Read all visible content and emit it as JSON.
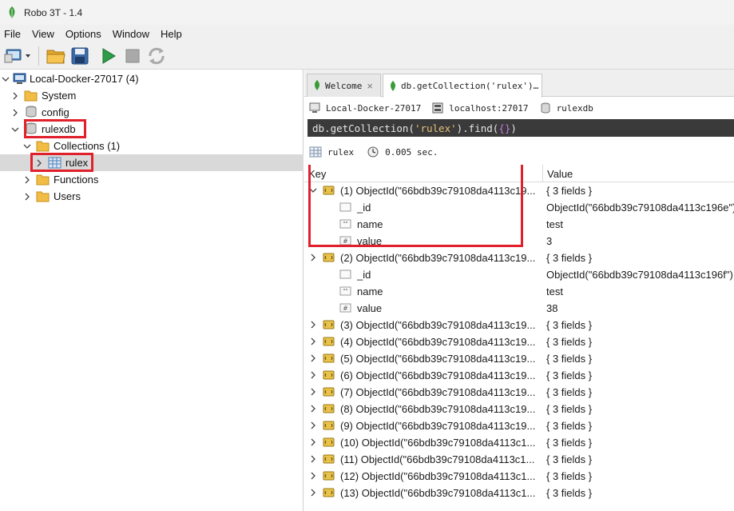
{
  "window": {
    "title": "Robo 3T - 1.4"
  },
  "menu": [
    "File",
    "View",
    "Options",
    "Window",
    "Help"
  ],
  "tree": {
    "connection": "Local-Docker-27017 (4)",
    "system": "System",
    "config": "config",
    "database": "rulexdb",
    "collections": "Collections (1)",
    "collection": "rulex",
    "functions": "Functions",
    "users": "Users"
  },
  "tabs": [
    {
      "label": "Welcome"
    },
    {
      "label": "db.getCollection('rulex')…"
    }
  ],
  "tab_close": "×",
  "connection_info": {
    "connection": "Local-Docker-27017",
    "host": "localhost:27017",
    "database": "rulexdb"
  },
  "query": {
    "part1": "db.getCollection(",
    "part2": "'rulex'",
    "part3": ").find(",
    "part4": "{}",
    "part5": ")"
  },
  "result": {
    "collection": "rulex",
    "time": "0.005 sec."
  },
  "grid": {
    "col_key": "Key",
    "col_value": "Value",
    "rows": [
      {
        "key": "(1) ObjectId(\"66bdb39c79108da4113c19...",
        "value": "{ 3 fields }"
      },
      {
        "key": "_id",
        "value": "ObjectId(\"66bdb39c79108da4113c196e\")"
      },
      {
        "key": "name",
        "value": "test"
      },
      {
        "key": "value",
        "value": "3"
      },
      {
        "key": "(2) ObjectId(\"66bdb39c79108da4113c19...",
        "value": "{ 3 fields }"
      },
      {
        "key": "_id",
        "value": "ObjectId(\"66bdb39c79108da4113c196f\")"
      },
      {
        "key": "name",
        "value": "test"
      },
      {
        "key": "value",
        "value": "38"
      },
      {
        "key": "(3) ObjectId(\"66bdb39c79108da4113c19...",
        "value": "{ 3 fields }"
      },
      {
        "key": "(4) ObjectId(\"66bdb39c79108da4113c19...",
        "value": "{ 3 fields }"
      },
      {
        "key": "(5) ObjectId(\"66bdb39c79108da4113c19...",
        "value": "{ 3 fields }"
      },
      {
        "key": "(6) ObjectId(\"66bdb39c79108da4113c19...",
        "value": "{ 3 fields }"
      },
      {
        "key": "(7) ObjectId(\"66bdb39c79108da4113c19...",
        "value": "{ 3 fields }"
      },
      {
        "key": "(8) ObjectId(\"66bdb39c79108da4113c19...",
        "value": "{ 3 fields }"
      },
      {
        "key": "(9) ObjectId(\"66bdb39c79108da4113c19...",
        "value": "{ 3 fields }"
      },
      {
        "key": "(10) ObjectId(\"66bdb39c79108da4113c1...",
        "value": "{ 3 fields }"
      },
      {
        "key": "(11) ObjectId(\"66bdb39c79108da4113c1...",
        "value": "{ 3 fields }"
      },
      {
        "key": "(12) ObjectId(\"66bdb39c79108da4113c1...",
        "value": "{ 3 fields }"
      },
      {
        "key": "(13) ObjectId(\"66bdb39c79108da4113c1...",
        "value": "{ 3 fields }"
      }
    ]
  },
  "icons": {
    "app": "robo3t-leaf-icon",
    "connect": "connect-icon",
    "open": "folder-open-icon",
    "save": "save-icon",
    "run": "play-icon",
    "stop": "stop-icon",
    "rotate": "rotate-icon"
  },
  "colors": {
    "highlight": "#e0212b",
    "selected_row": "#d9d9d9",
    "query_bg": "#3a3a3a",
    "leaf": "#3a9b3a"
  }
}
